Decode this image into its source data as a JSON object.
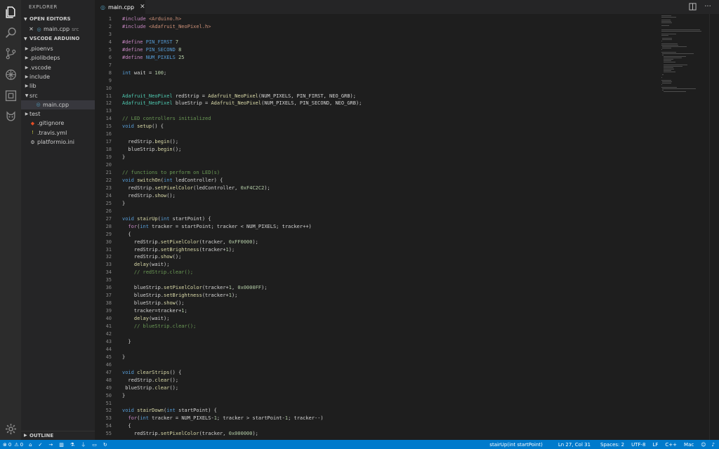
{
  "sidebar": {
    "title": "EXPLORER",
    "open_editors_label": "OPEN EDITORS",
    "open_file_name": "main.cpp",
    "open_file_folder": "src",
    "project_label": "VSCODE ARDUINO",
    "tree": [
      {
        "name": ".pioenvs",
        "type": "folder",
        "depth": 0
      },
      {
        "name": ".piolibdeps",
        "type": "folder",
        "depth": 0
      },
      {
        "name": ".vscode",
        "type": "folder",
        "depth": 0
      },
      {
        "name": "include",
        "type": "folder",
        "depth": 0
      },
      {
        "name": "lib",
        "type": "folder",
        "depth": 0
      },
      {
        "name": "src",
        "type": "folder-open",
        "depth": 0
      },
      {
        "name": "main.cpp",
        "type": "cpp",
        "depth": 1,
        "active": true
      },
      {
        "name": "test",
        "type": "folder",
        "depth": 0
      },
      {
        "name": ".gitignore",
        "type": "git",
        "depth": 0
      },
      {
        "name": ".travis.yml",
        "type": "yml",
        "depth": 0
      },
      {
        "name": "platformio.ini",
        "type": "ini",
        "depth": 0
      }
    ],
    "outline_label": "OUTLINE"
  },
  "tabs": [
    {
      "label": "main.cpp"
    }
  ],
  "editor": {
    "lines": [
      {
        "n": "1",
        "t": [
          [
            "pp",
            "#include "
          ],
          [
            "str",
            "<Arduino.h>"
          ]
        ]
      },
      {
        "n": "2",
        "t": [
          [
            "pp",
            "#include "
          ],
          [
            "str",
            "<Adafruit_NeoPixel.h>"
          ]
        ]
      },
      {
        "n": "3",
        "t": []
      },
      {
        "n": "4",
        "t": [
          [
            "pp",
            "#define "
          ],
          [
            "mac",
            "PIN_FIRST"
          ],
          [
            "id",
            " "
          ],
          [
            "nu",
            "7"
          ]
        ]
      },
      {
        "n": "5",
        "t": [
          [
            "pp",
            "#define "
          ],
          [
            "mac",
            "PIN_SECOND"
          ],
          [
            "id",
            " "
          ],
          [
            "nu",
            "8"
          ]
        ]
      },
      {
        "n": "6",
        "t": [
          [
            "pp",
            "#define "
          ],
          [
            "mac",
            "NUM_PIXELS"
          ],
          [
            "id",
            " "
          ],
          [
            "nu",
            "25"
          ]
        ]
      },
      {
        "n": "7",
        "t": []
      },
      {
        "n": "8",
        "t": [
          [
            "kw",
            "int"
          ],
          [
            "id",
            " wait = "
          ],
          [
            "nu",
            "100"
          ],
          [
            "id",
            ";"
          ]
        ]
      },
      {
        "n": "9",
        "t": []
      },
      {
        "n": "10",
        "t": []
      },
      {
        "n": "11",
        "t": [
          [
            "ty",
            "Adafruit_NeoPixel"
          ],
          [
            "id",
            " redStrip = "
          ],
          [
            "fn",
            "Adafruit_NeoPixel"
          ],
          [
            "id",
            "(NUM_PIXELS, PIN_FIRST, NEO_GRB);"
          ]
        ]
      },
      {
        "n": "12",
        "t": [
          [
            "ty",
            "Adafruit_NeoPixel"
          ],
          [
            "id",
            " blueStrip = "
          ],
          [
            "fn",
            "Adafruit_NeoPixel"
          ],
          [
            "id",
            "(NUM_PIXELS, PIN_SECOND, NEO_GRB);"
          ]
        ]
      },
      {
        "n": "13",
        "t": []
      },
      {
        "n": "14",
        "t": [
          [
            "cm",
            "// LED controllers initialized"
          ]
        ]
      },
      {
        "n": "15",
        "t": [
          [
            "kw",
            "void"
          ],
          [
            "id",
            " "
          ],
          [
            "fn",
            "setup"
          ],
          [
            "id",
            "() {"
          ]
        ]
      },
      {
        "n": "16",
        "t": []
      },
      {
        "n": "17",
        "t": [
          [
            "id",
            "  redStrip."
          ],
          [
            "fn",
            "begin"
          ],
          [
            "id",
            "();"
          ]
        ]
      },
      {
        "n": "18",
        "t": [
          [
            "id",
            "  blueStrip."
          ],
          [
            "fn",
            "begin"
          ],
          [
            "id",
            "();"
          ]
        ]
      },
      {
        "n": "19",
        "t": [
          [
            "id",
            "}"
          ]
        ]
      },
      {
        "n": "20",
        "t": []
      },
      {
        "n": "21",
        "t": [
          [
            "cm",
            "// functions to perform on LED(s)"
          ]
        ]
      },
      {
        "n": "22",
        "t": [
          [
            "kw",
            "void"
          ],
          [
            "id",
            " "
          ],
          [
            "fn",
            "switchOn"
          ],
          [
            "id",
            "("
          ],
          [
            "kw",
            "int"
          ],
          [
            "id",
            " ledController) {"
          ]
        ]
      },
      {
        "n": "23",
        "t": [
          [
            "id",
            "  redStrip."
          ],
          [
            "fn",
            "setPixelColor"
          ],
          [
            "id",
            "(ledController, "
          ],
          [
            "nu",
            "0xF4C2C2"
          ],
          [
            "id",
            ");"
          ]
        ]
      },
      {
        "n": "24",
        "t": [
          [
            "id",
            "  redStrip."
          ],
          [
            "fn",
            "show"
          ],
          [
            "id",
            "();"
          ]
        ]
      },
      {
        "n": "25",
        "t": [
          [
            "id",
            "}"
          ]
        ]
      },
      {
        "n": "26",
        "t": []
      },
      {
        "n": "27",
        "t": [
          [
            "kw",
            "void"
          ],
          [
            "id",
            " "
          ],
          [
            "fn",
            "stairUp"
          ],
          [
            "id",
            "("
          ],
          [
            "kw",
            "int"
          ],
          [
            "id",
            " startPoint) {"
          ]
        ]
      },
      {
        "n": "28",
        "t": [
          [
            "id",
            "  "
          ],
          [
            "pp",
            "for"
          ],
          [
            "id",
            "("
          ],
          [
            "kw",
            "int"
          ],
          [
            "id",
            " tracker = startPoint; tracker < NUM_PIXELS; tracker++)"
          ]
        ]
      },
      {
        "n": "29",
        "t": [
          [
            "id",
            "  {"
          ]
        ]
      },
      {
        "n": "30",
        "t": [
          [
            "id",
            "    redStrip."
          ],
          [
            "fn",
            "setPixelColor"
          ],
          [
            "id",
            "(tracker, "
          ],
          [
            "nu",
            "0xFF0000"
          ],
          [
            "id",
            ");"
          ]
        ]
      },
      {
        "n": "31",
        "t": [
          [
            "id",
            "    redStrip."
          ],
          [
            "fn",
            "setBrightness"
          ],
          [
            "id",
            "(tracker+"
          ],
          [
            "nu",
            "1"
          ],
          [
            "id",
            ");"
          ]
        ]
      },
      {
        "n": "32",
        "t": [
          [
            "id",
            "    redStrip."
          ],
          [
            "fn",
            "show"
          ],
          [
            "id",
            "();"
          ]
        ]
      },
      {
        "n": "33",
        "t": [
          [
            "id",
            "    "
          ],
          [
            "fn",
            "delay"
          ],
          [
            "id",
            "(wait);"
          ]
        ]
      },
      {
        "n": "34",
        "t": [
          [
            "id",
            "    "
          ],
          [
            "cm",
            "// redStrip.clear();"
          ]
        ]
      },
      {
        "n": "35",
        "t": []
      },
      {
        "n": "36",
        "t": [
          [
            "id",
            "    blueStrip."
          ],
          [
            "fn",
            "setPixelColor"
          ],
          [
            "id",
            "(tracker+"
          ],
          [
            "nu",
            "1"
          ],
          [
            "id",
            ", "
          ],
          [
            "nu",
            "0x0000FF"
          ],
          [
            "id",
            ");"
          ]
        ]
      },
      {
        "n": "37",
        "t": [
          [
            "id",
            "    blueStrip."
          ],
          [
            "fn",
            "setBrightness"
          ],
          [
            "id",
            "(tracker+"
          ],
          [
            "nu",
            "1"
          ],
          [
            "id",
            ");"
          ]
        ]
      },
      {
        "n": "38",
        "t": [
          [
            "id",
            "    blueStrip."
          ],
          [
            "fn",
            "show"
          ],
          [
            "id",
            "();"
          ]
        ]
      },
      {
        "n": "39",
        "t": [
          [
            "id",
            "    tracker=tracker+"
          ],
          [
            "nu",
            "1"
          ],
          [
            "id",
            ";"
          ]
        ]
      },
      {
        "n": "40",
        "t": [
          [
            "id",
            "    "
          ],
          [
            "fn",
            "delay"
          ],
          [
            "id",
            "(wait);"
          ]
        ]
      },
      {
        "n": "41",
        "t": [
          [
            "id",
            "    "
          ],
          [
            "cm",
            "// blueStrip.clear();"
          ]
        ]
      },
      {
        "n": "42",
        "t": []
      },
      {
        "n": "43",
        "t": [
          [
            "id",
            "  }"
          ]
        ]
      },
      {
        "n": "44",
        "t": []
      },
      {
        "n": "45",
        "t": [
          [
            "id",
            "}"
          ]
        ]
      },
      {
        "n": "46",
        "t": []
      },
      {
        "n": "47",
        "t": [
          [
            "kw",
            "void"
          ],
          [
            "id",
            " "
          ],
          [
            "fn",
            "clearStrips"
          ],
          [
            "id",
            "() {"
          ]
        ]
      },
      {
        "n": "48",
        "t": [
          [
            "id",
            "  redStrip."
          ],
          [
            "fn",
            "clear"
          ],
          [
            "id",
            "();"
          ]
        ]
      },
      {
        "n": "49",
        "t": [
          [
            "id",
            " blueStrip."
          ],
          [
            "fn",
            "clear"
          ],
          [
            "id",
            "();"
          ]
        ]
      },
      {
        "n": "50",
        "t": [
          [
            "id",
            "}"
          ]
        ]
      },
      {
        "n": "51",
        "t": []
      },
      {
        "n": "52",
        "t": [
          [
            "kw",
            "void"
          ],
          [
            "id",
            " "
          ],
          [
            "fn",
            "stairDown"
          ],
          [
            "id",
            "("
          ],
          [
            "kw",
            "int"
          ],
          [
            "id",
            " startPoint) {"
          ]
        ]
      },
      {
        "n": "53",
        "t": [
          [
            "id",
            "  "
          ],
          [
            "pp",
            "for"
          ],
          [
            "id",
            "("
          ],
          [
            "kw",
            "int"
          ],
          [
            "id",
            " tracker = NUM_PIXELS-"
          ],
          [
            "nu",
            "1"
          ],
          [
            "id",
            "; tracker > startPoint-"
          ],
          [
            "nu",
            "1"
          ],
          [
            "id",
            "; tracker--)"
          ]
        ]
      },
      {
        "n": "54",
        "t": [
          [
            "id",
            "  {"
          ]
        ]
      },
      {
        "n": "55",
        "t": [
          [
            "id",
            "    redStrip."
          ],
          [
            "fn",
            "setPixelColor"
          ],
          [
            "id",
            "(tracker, "
          ],
          [
            "nu",
            "0x000000"
          ],
          [
            "id",
            ");"
          ]
        ]
      }
    ]
  },
  "statusbar": {
    "errors": "0",
    "warnings": "0",
    "function": "stairUp(int startPoint)",
    "cursor": "Ln 27, Col 31",
    "spaces": "Spaces: 2",
    "encoding": "UTF-8",
    "eol": "LF",
    "language": "C++",
    "platform": "Mac"
  },
  "colors": {
    "status_bar": "#007acc",
    "editor_bg": "#1e1e1e",
    "sidebar_bg": "#252526",
    "activity_bar": "#2c2c2c"
  }
}
